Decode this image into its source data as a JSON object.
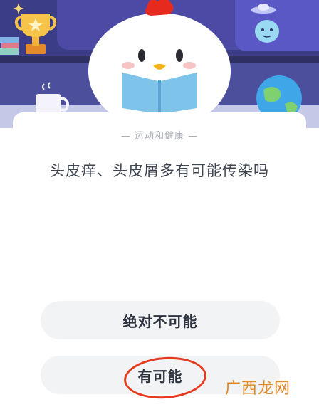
{
  "question_page": {
    "category": "— 运动和健康 —",
    "question": "头皮痒、头皮屑多有可能传染吗",
    "options": [
      "绝对不可能",
      "有可能"
    ]
  },
  "watermark": {
    "text": "广西龙网"
  },
  "colors": {
    "accent_circle": "#e53b1f",
    "option_bg": "#f2f3f5",
    "banner_bg": "#3a3f7e"
  }
}
